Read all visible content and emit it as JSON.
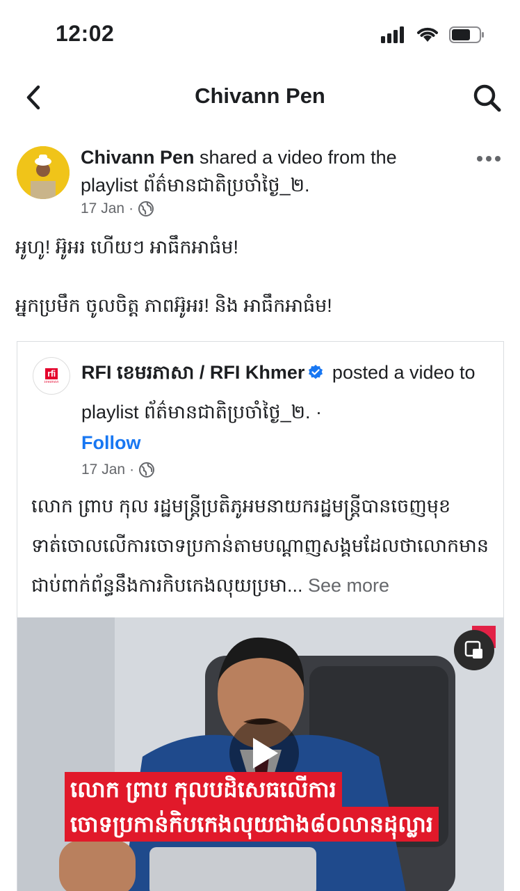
{
  "status_bar": {
    "time": "12:02"
  },
  "header": {
    "title": "Chivann Pen"
  },
  "post": {
    "author": "Chivann Pen",
    "action_text": " shared a video from the playlist ព័ត៌មានជាតិប្រចាំថ្ងៃ_២.",
    "date": "17 Jan",
    "meta_separator": "·",
    "text_line_1": "អូហូ! អ៊ូអរ ហើយៗ អាធឹកអាធំម!",
    "text_line_2": "អ្នកប្រមឹក ចូលចិត្ត ភាពអ៊ូអរ! និង អាធឹកអាធំម!"
  },
  "shared": {
    "author": "RFI ខេមរភាសា / RFI Khmer",
    "action_text": " posted a video to playlist ព័ត៌មានជាតិប្រចាំថ្ងៃ_២. ·",
    "follow_label": "Follow",
    "date": "17 Jan",
    "meta_separator": "·",
    "logo_text": "rfi",
    "logo_sub": "ខេមរភាសា",
    "body": "លោក ព្រាប កុល រដ្ឋមន្ត្រីប្រតិភូអមនាយករដ្ឋមន្ត្រីបានចេញមុខទាត់ចោលលើការចោទប្រកាន់តាមបណ្ដាញសង្គមដែលថាលោកមានជាប់ពាក់ព័ន្ធនឹងការកិបកេងលុយប្រមា...",
    "see_more": " See more",
    "video": {
      "caption_line_1": "លោក ព្រាប កុលបដិសេធលើការ",
      "caption_line_2": "ចោទប្រកាន់កិបកេងលុយជាង៨០លានដុល្លារ"
    }
  },
  "colors": {
    "accent": "#1877f2",
    "brand_red": "#e4002b",
    "meta_gray": "#65676b",
    "caption_red": "#e1192a"
  }
}
